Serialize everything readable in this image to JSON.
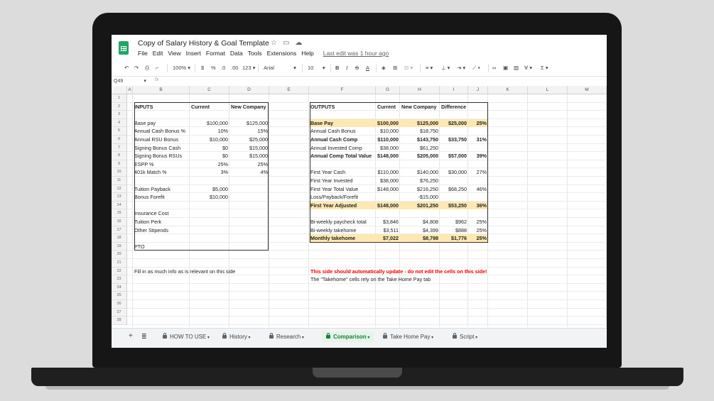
{
  "doc": {
    "title": "Copy of Salary History & Goal Template",
    "menu": [
      "File",
      "Edit",
      "View",
      "Insert",
      "Format",
      "Data",
      "Tools",
      "Extensions",
      "Help"
    ],
    "last_edit": "Last edit was 1 hour ago"
  },
  "toolbar": {
    "zoom": "100%",
    "currency": "$",
    "percent": "%",
    "dec_less": ".0",
    "dec_more": ".00",
    "format_more": "123",
    "font": "Arial",
    "font_size": "10"
  },
  "formula": {
    "cell_ref": "Q49",
    "fx": "fx"
  },
  "columns": [
    "A",
    "B",
    "C",
    "D",
    "E",
    "F",
    "G",
    "H",
    "I",
    "J",
    "K",
    "L",
    "M"
  ],
  "rows": [
    "1",
    "2",
    "3",
    "4",
    "5",
    "6",
    "7",
    "8",
    "9",
    "10",
    "11",
    "12",
    "13",
    "14",
    "15",
    "16",
    "17",
    "18",
    "19",
    "20",
    "21",
    "22",
    "23",
    "24",
    "25",
    "26",
    "27",
    "28"
  ],
  "inputs": {
    "header": [
      "INPUTS",
      "Current",
      "New Company"
    ],
    "rows": [
      {
        "row": 4,
        "label": "Base pay",
        "current": "$100,000",
        "new": "$125,000"
      },
      {
        "row": 5,
        "label": "Annual Cash Bonus %",
        "current": "10%",
        "new": "15%"
      },
      {
        "row": 6,
        "label": "Annual RSU Bonus",
        "current": "$10,000",
        "new": "$25,000"
      },
      {
        "row": 7,
        "label": "Signing Bonus Cash",
        "current": "$0",
        "new": "$15,000"
      },
      {
        "row": 8,
        "label": "Signing Bonus RSUs",
        "current": "$0",
        "new": "$15,000"
      },
      {
        "row": 9,
        "label": "ESPP %",
        "current": "25%",
        "new": "25%"
      },
      {
        "row": 10,
        "label": "401k Match %",
        "current": "3%",
        "new": "4%"
      },
      {
        "row": 12,
        "label": "Tuition Payback",
        "current": "$5,000",
        "new": ""
      },
      {
        "row": 13,
        "label": "Bonus Forefit",
        "current": "$10,000",
        "new": ""
      },
      {
        "row": 15,
        "label": "Insurance Cost",
        "current": "",
        "new": ""
      },
      {
        "row": 16,
        "label": "Tuition Perk",
        "current": "",
        "new": ""
      },
      {
        "row": 17,
        "label": "Other Stipends",
        "current": "",
        "new": ""
      },
      {
        "row": 19,
        "label": "PTO",
        "current": "",
        "new": ""
      }
    ]
  },
  "outputs": {
    "header": [
      "OUTPUTS",
      "Current",
      "New Company",
      "Difference"
    ],
    "rows": [
      {
        "row": 4,
        "label": "Base Pay",
        "current": "$100,000",
        "new": "$125,000",
        "diff": "$25,000",
        "pct": "25%",
        "bold": true,
        "hl": true
      },
      {
        "row": 5,
        "label": "Annual Cash Bonus",
        "current": "$10,000",
        "new": "$18,750",
        "diff": "",
        "pct": "",
        "bold": false,
        "hl": false
      },
      {
        "row": 6,
        "label": "Annual Cash Comp",
        "current": "$110,000",
        "new": "$143,750",
        "diff": "$33,750",
        "pct": "31%",
        "bold": true,
        "hl": false
      },
      {
        "row": 7,
        "label": "Annual Invested Comp",
        "current": "$38,000",
        "new": "$61,250",
        "diff": "",
        "pct": "",
        "bold": false,
        "hl": false
      },
      {
        "row": 8,
        "label": "Annual Comp Total Value",
        "current": "$148,000",
        "new": "$205,000",
        "diff": "$57,000",
        "pct": "39%",
        "bold": true,
        "hl": false
      },
      {
        "row": 10,
        "label": "First Year Cash",
        "current": "$110,000",
        "new": "$140,000",
        "diff": "$30,000",
        "pct": "27%",
        "bold": false,
        "hl": false
      },
      {
        "row": 11,
        "label": "First Year Invested",
        "current": "$38,000",
        "new": "$76,250",
        "diff": "",
        "pct": "",
        "bold": false,
        "hl": false
      },
      {
        "row": 12,
        "label": "First Year Total Value",
        "current": "$148,000",
        "new": "$216,250",
        "diff": "$68,250",
        "pct": "46%",
        "bold": false,
        "hl": false
      },
      {
        "row": 13,
        "label": "Loss/Payback/Forefit",
        "current": "",
        "new": "-$15,000",
        "diff": "",
        "pct": "",
        "bold": false,
        "hl": false
      },
      {
        "row": 14,
        "label": "First Year Adjusted",
        "current": "$148,000",
        "new": "$201,250",
        "diff": "$53,250",
        "pct": "36%",
        "bold": true,
        "hl": true
      },
      {
        "row": 16,
        "label": "Bi-weekly paycheck total",
        "current": "$3,846",
        "new": "$4,808",
        "diff": "$962",
        "pct": "25%",
        "bold": false,
        "hl": false
      },
      {
        "row": 17,
        "label": "Bi-weekly takehome",
        "current": "$3,511",
        "new": "$4,399",
        "diff": "$888",
        "pct": "25%",
        "bold": false,
        "hl": false
      },
      {
        "row": 18,
        "label": "Monthly takehome",
        "current": "$7,022",
        "new": "$8,798",
        "diff": "$1,776",
        "pct": "25%",
        "bold": true,
        "hl": true
      }
    ]
  },
  "notes": {
    "left": "Fill in as much info as is relevant on this side",
    "right_warning": "This side should automatically update - do not edit the cells on this side!",
    "right_note": "The \"Takehome\" cells rely on the Take Home Pay tab"
  },
  "tabs": [
    {
      "label": "HOW TO USE",
      "active": false
    },
    {
      "label": "History",
      "active": false
    },
    {
      "label": "Research",
      "active": false
    },
    {
      "label": "Comparison",
      "active": true
    },
    {
      "label": "Take Home Pay",
      "active": false
    },
    {
      "label": "Script",
      "active": false
    }
  ],
  "colors": {
    "highlight": "#fce8b2",
    "sheets_green": "#23a566",
    "active_tab": "#188038",
    "warning": "#e00000"
  }
}
